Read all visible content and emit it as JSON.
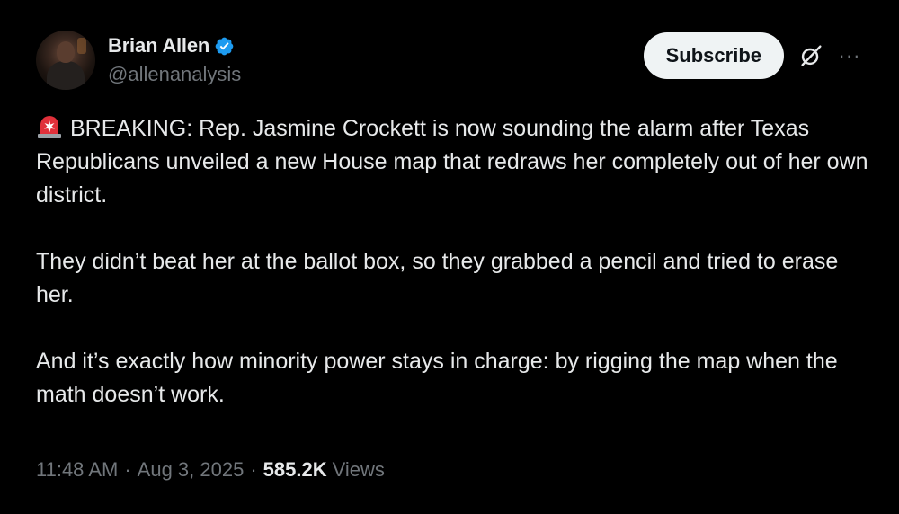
{
  "author": {
    "display_name": "Brian Allen",
    "handle": "@allenanalysis",
    "verified": true,
    "verified_color": "#1d9bf0"
  },
  "actions": {
    "subscribe_label": "Subscribe",
    "grok_icon": "grok-slash-icon",
    "more_icon": "more-dots-icon",
    "more_label": "···"
  },
  "tweet": {
    "emoji_icon": "police-siren-icon",
    "paragraphs": [
      "BREAKING: Rep. Jasmine Crockett is now sounding the alarm after Texas Republicans unveiled a new House map that redraws her completely out of her own district.",
      "They didn’t beat her at the ballot box, so they grabbed a pencil and tried to erase her.",
      "And it’s exactly how minority power stays in charge: by rigging the map when the math doesn’t work."
    ]
  },
  "meta": {
    "time": "11:48 AM",
    "separator": "·",
    "date": "Aug 3, 2025",
    "views_count": "585.2K",
    "views_label": "Views"
  },
  "colors": {
    "background": "#000000",
    "text": "#e7e9ea",
    "muted": "#71767b",
    "button_bg": "#eff3f4",
    "siren_red": "#e0303a"
  }
}
